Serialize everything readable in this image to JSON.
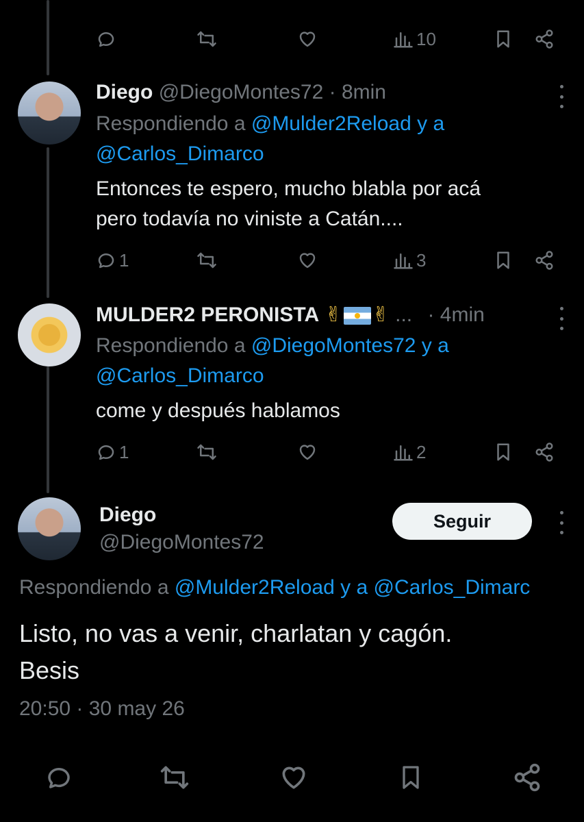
{
  "top_actions": {
    "views": "10"
  },
  "tweet1": {
    "name": "Diego",
    "handle": "@DiegoMontes72",
    "time": "· 8min",
    "reply_prefix": "Respondiendo a",
    "reply_user1": "@Mulder2Reload",
    "reply_joiner": "y a",
    "reply_user2": "@Carlos_Dimarco",
    "line1": "Entonces te espero, mucho blabla por acá",
    "line2": "pero todavía no viniste a Catán....",
    "replies": "1",
    "views": "3"
  },
  "tweet2": {
    "name": "MULDER2 PERONISTA",
    "emoji_left": "✌",
    "emoji_right": "✌",
    "ellipsis": "...",
    "time": "· 4min",
    "reply_prefix": "Respondiendo a",
    "reply_user1": "@DiegoMontes72",
    "reply_joiner": "y a",
    "reply_user2": "@Carlos_Dimarco",
    "text": "come y después hablamos",
    "replies": "1",
    "views": "2"
  },
  "main_tweet": {
    "name": "Diego",
    "handle": "@DiegoMontes72",
    "follow_label": "Seguir",
    "reply_prefix": "Respondiendo a",
    "reply_user1": "@Mulder2Reload",
    "reply_joiner": "y a",
    "reply_user2": "@Carlos_Dimarc",
    "line1": "Listo, no vas a venir, charlatan y cagón.",
    "line2": "Besis",
    "timestamp": "20:50 · 30 may 26"
  },
  "icons": [
    "reply-icon",
    "retweet-icon",
    "like-icon",
    "views-icon",
    "bookmark-icon",
    "share-icon",
    "more-icon"
  ],
  "colors": {
    "background": "#000000",
    "text": "#e7e9ea",
    "muted": "#71767b",
    "link": "#1d9bf0",
    "button_bg": "#eff3f4"
  }
}
